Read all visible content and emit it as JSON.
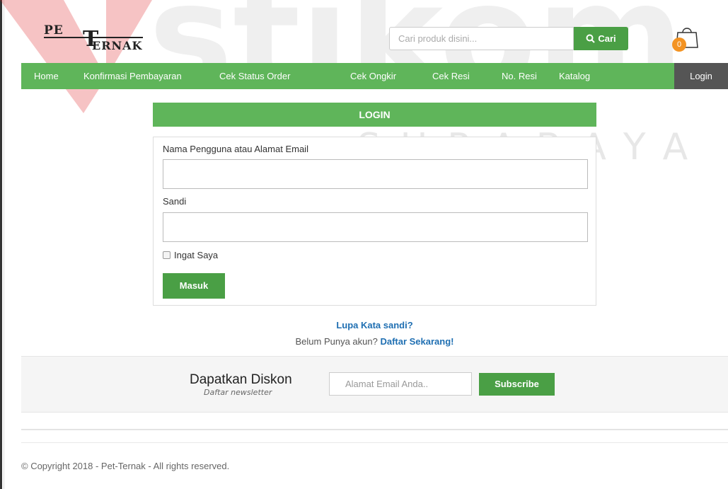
{
  "logo": {
    "pe": "PE",
    "t": "T",
    "ernak": "ERNAK"
  },
  "watermark": {
    "brand": "stikom",
    "city": "SURABAYA"
  },
  "search": {
    "placeholder": "Cari produk disini...",
    "button_label": "Cari"
  },
  "cart": {
    "count": "0"
  },
  "nav": {
    "items": [
      {
        "label": "Home"
      },
      {
        "label": "Konfirmasi Pembayaran"
      },
      {
        "label": "Cek Status Order"
      },
      {
        "label": "Cek Ongkir"
      },
      {
        "label": "Cek Resi"
      },
      {
        "label": "No. Resi"
      },
      {
        "label": "Katalog"
      }
    ],
    "login_label": "Login"
  },
  "login": {
    "title": "LOGIN",
    "username_label": "Nama Pengguna atau Alamat Email",
    "username_value": "",
    "password_label": "Sandi",
    "password_value": "",
    "remember_label": "Ingat Saya",
    "submit_label": "Masuk",
    "forgot_label": "Lupa Kata sandi?",
    "register_prefix": "Belum Punya akun? ",
    "register_link": "Daftar Sekarang!"
  },
  "newsletter": {
    "title": "Dapatkan Diskon",
    "subtitle": "Daftar newsletter",
    "placeholder": "Alamat Email Anda..",
    "button_label": "Subscribe"
  },
  "footer": {
    "copyright": "© Copyright 2018 - Pet-Ternak - All rights reserved."
  },
  "colors": {
    "brand_green": "#5fb55a",
    "button_green": "#4a9f45",
    "link_blue": "#1f6fb2",
    "cart_badge": "#f39322",
    "watermark_red": "#e0262b"
  }
}
